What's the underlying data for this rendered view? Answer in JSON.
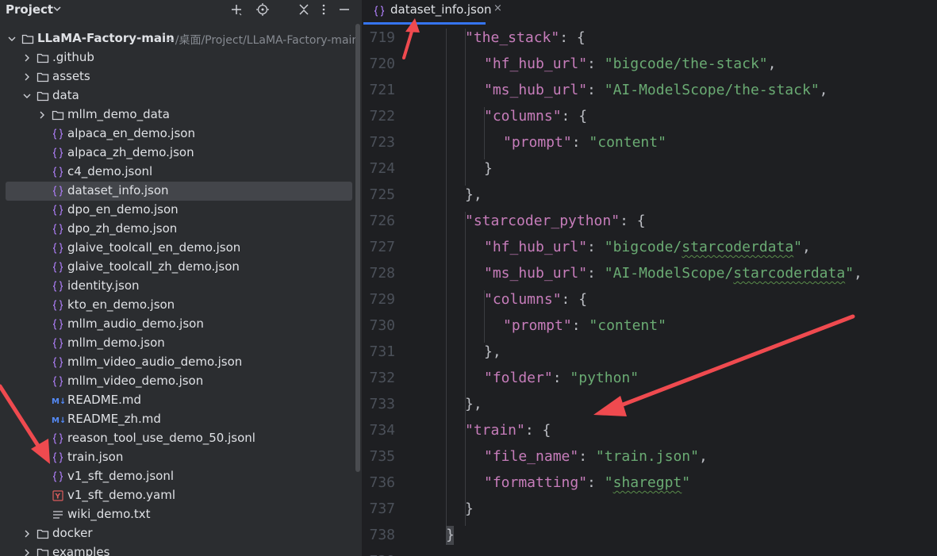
{
  "project": {
    "title": "Project",
    "root_name": "LLaMA-Factory-main",
    "root_path": "~/桌面/Project/LLaMA-Factory-main"
  },
  "header_icons": [
    "add-icon",
    "locate-icon",
    "collapse-icon",
    "more-icon",
    "minimize-icon"
  ],
  "tree": [
    {
      "label": "LLaMA-Factory-main",
      "kind": "folder",
      "expanded": true,
      "depth": 0
    },
    {
      "label": ".github",
      "kind": "folder",
      "expanded": false,
      "depth": 1
    },
    {
      "label": "assets",
      "kind": "folder",
      "expanded": false,
      "depth": 1
    },
    {
      "label": "data",
      "kind": "folder",
      "expanded": true,
      "depth": 1
    },
    {
      "label": "mllm_demo_data",
      "kind": "folder",
      "expanded": false,
      "depth": 2
    },
    {
      "label": "alpaca_en_demo.json",
      "kind": "json",
      "depth": 2
    },
    {
      "label": "alpaca_zh_demo.json",
      "kind": "json",
      "depth": 2
    },
    {
      "label": "c4_demo.jsonl",
      "kind": "json",
      "depth": 2
    },
    {
      "label": "dataset_info.json",
      "kind": "json",
      "depth": 2,
      "selected": true
    },
    {
      "label": "dpo_en_demo.json",
      "kind": "json",
      "depth": 2
    },
    {
      "label": "dpo_zh_demo.json",
      "kind": "json",
      "depth": 2
    },
    {
      "label": "glaive_toolcall_en_demo.json",
      "kind": "json",
      "depth": 2
    },
    {
      "label": "glaive_toolcall_zh_demo.json",
      "kind": "json",
      "depth": 2
    },
    {
      "label": "identity.json",
      "kind": "json",
      "depth": 2
    },
    {
      "label": "kto_en_demo.json",
      "kind": "json",
      "depth": 2
    },
    {
      "label": "mllm_audio_demo.json",
      "kind": "json",
      "depth": 2
    },
    {
      "label": "mllm_demo.json",
      "kind": "json",
      "depth": 2
    },
    {
      "label": "mllm_video_audio_demo.json",
      "kind": "json",
      "depth": 2
    },
    {
      "label": "mllm_video_demo.json",
      "kind": "json",
      "depth": 2
    },
    {
      "label": "README.md",
      "kind": "markdown",
      "depth": 2
    },
    {
      "label": "README_zh.md",
      "kind": "markdown",
      "depth": 2
    },
    {
      "label": "reason_tool_use_demo_50.jsonl",
      "kind": "json",
      "depth": 2
    },
    {
      "label": "train.json",
      "kind": "json",
      "depth": 2
    },
    {
      "label": "v1_sft_demo.jsonl",
      "kind": "json",
      "depth": 2
    },
    {
      "label": "v1_sft_demo.yaml",
      "kind": "yaml",
      "depth": 2
    },
    {
      "label": "wiki_demo.txt",
      "kind": "text",
      "depth": 2
    },
    {
      "label": "docker",
      "kind": "folder",
      "expanded": false,
      "depth": 1
    },
    {
      "label": "examples",
      "kind": "folder",
      "expanded": false,
      "depth": 1
    }
  ],
  "editor": {
    "tab": {
      "label": "dataset_info.json",
      "close_glyph": "×"
    },
    "lines": [
      {
        "n": "719",
        "indent": 1,
        "tokens": [
          [
            "k",
            "\"the_stack\""
          ],
          [
            "p",
            ": {"
          ]
        ]
      },
      {
        "n": "720",
        "indent": 2,
        "tokens": [
          [
            "k",
            "\"hf_hub_url\""
          ],
          [
            "p",
            ": "
          ],
          [
            "s",
            "\"bigcode/the-stack\""
          ],
          [
            "p",
            ","
          ]
        ]
      },
      {
        "n": "721",
        "indent": 2,
        "tokens": [
          [
            "k",
            "\"ms_hub_url\""
          ],
          [
            "p",
            ": "
          ],
          [
            "s",
            "\"AI-ModelScope/the-stack\""
          ],
          [
            "p",
            ","
          ]
        ]
      },
      {
        "n": "722",
        "indent": 2,
        "tokens": [
          [
            "k",
            "\"columns\""
          ],
          [
            "p",
            ": {"
          ]
        ]
      },
      {
        "n": "723",
        "indent": 3,
        "tokens": [
          [
            "k",
            "\"prompt\""
          ],
          [
            "p",
            ": "
          ],
          [
            "s",
            "\"content\""
          ]
        ]
      },
      {
        "n": "724",
        "indent": 2,
        "tokens": [
          [
            "p",
            "}"
          ]
        ]
      },
      {
        "n": "725",
        "indent": 1,
        "tokens": [
          [
            "p",
            "},"
          ]
        ]
      },
      {
        "n": "726",
        "indent": 1,
        "tokens": [
          [
            "k",
            "\"starcoder_python\""
          ],
          [
            "p",
            ": {"
          ]
        ]
      },
      {
        "n": "727",
        "indent": 2,
        "tokens": [
          [
            "k",
            "\"hf_hub_url\""
          ],
          [
            "p",
            ": "
          ],
          [
            "s",
            "\"bigcode/"
          ],
          [
            "sq",
            "starcoderdata"
          ],
          [
            "s",
            "\""
          ],
          [
            "p",
            ","
          ]
        ]
      },
      {
        "n": "728",
        "indent": 2,
        "tokens": [
          [
            "k",
            "\"ms_hub_url\""
          ],
          [
            "p",
            ": "
          ],
          [
            "s",
            "\"AI-ModelScope/"
          ],
          [
            "sq",
            "starcoderdata"
          ],
          [
            "s",
            "\""
          ],
          [
            "p",
            ","
          ]
        ]
      },
      {
        "n": "729",
        "indent": 2,
        "tokens": [
          [
            "k",
            "\"columns\""
          ],
          [
            "p",
            ": {"
          ]
        ]
      },
      {
        "n": "730",
        "indent": 3,
        "tokens": [
          [
            "k",
            "\"prompt\""
          ],
          [
            "p",
            ": "
          ],
          [
            "s",
            "\"content\""
          ]
        ]
      },
      {
        "n": "731",
        "indent": 2,
        "tokens": [
          [
            "p",
            "},"
          ]
        ]
      },
      {
        "n": "732",
        "indent": 2,
        "tokens": [
          [
            "k",
            "\"folder\""
          ],
          [
            "p",
            ": "
          ],
          [
            "s",
            "\"python\""
          ]
        ]
      },
      {
        "n": "733",
        "indent": 1,
        "tokens": [
          [
            "p",
            "},"
          ]
        ]
      },
      {
        "n": "734",
        "indent": 1,
        "tokens": [
          [
            "k",
            "\"train\""
          ],
          [
            "p",
            ": {"
          ]
        ]
      },
      {
        "n": "735",
        "indent": 2,
        "tokens": [
          [
            "k",
            "\"file_name\""
          ],
          [
            "p",
            ": "
          ],
          [
            "s",
            "\"train.json\""
          ],
          [
            "p",
            ","
          ]
        ]
      },
      {
        "n": "736",
        "indent": 2,
        "tokens": [
          [
            "k",
            "\"formatting\""
          ],
          [
            "p",
            ": "
          ],
          [
            "s",
            "\""
          ],
          [
            "sq",
            "sharegpt"
          ],
          [
            "s",
            "\""
          ]
        ]
      },
      {
        "n": "737",
        "indent": 1,
        "tokens": [
          [
            "p",
            "}"
          ]
        ]
      },
      {
        "n": "738",
        "indent": 0,
        "tokens": [
          [
            "p",
            "}"
          ]
        ]
      },
      {
        "n": "739",
        "indent": 0,
        "tokens": []
      }
    ]
  },
  "colors": {
    "accent": "#3574f0",
    "annotation_arrow": "#ef4a4f",
    "json_key": "#c77dbb",
    "json_string": "#6aab73",
    "folder_icon": "#ced0d6",
    "json_icon": "#a97bf0",
    "markdown_icon": "#548af7",
    "yaml_icon": "#db5c5c"
  }
}
